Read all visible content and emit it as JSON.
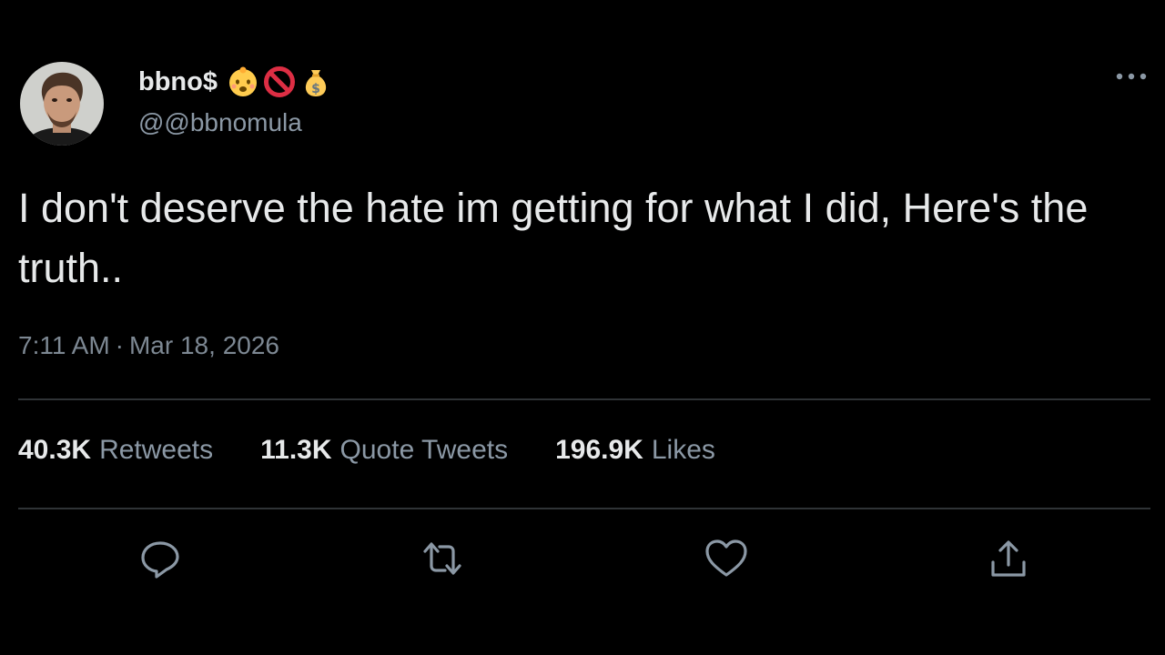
{
  "author": {
    "display_name": "bbno$",
    "handle": "@@bbnomula",
    "emojis": [
      "baby-emoji",
      "prohibited-emoji",
      "money-bag-emoji"
    ]
  },
  "tweet": {
    "text": "I don't deserve the hate im getting for what I did, Here's the truth..",
    "time": "7:11 AM",
    "separator": "·",
    "date": "Mar 18, 2026"
  },
  "stats": {
    "retweets": {
      "count": "40.3K",
      "label": "Retweets"
    },
    "quote_tweets": {
      "count": "11.3K",
      "label": "Quote Tweets"
    },
    "likes": {
      "count": "196.9K",
      "label": "Likes"
    }
  },
  "actions": [
    "reply-icon",
    "retweet-icon",
    "like-icon",
    "share-icon"
  ],
  "colors": {
    "background": "#000000",
    "primary_text": "#e7e9ea",
    "secondary_text": "#8b98a5",
    "divider": "#2f3336"
  }
}
